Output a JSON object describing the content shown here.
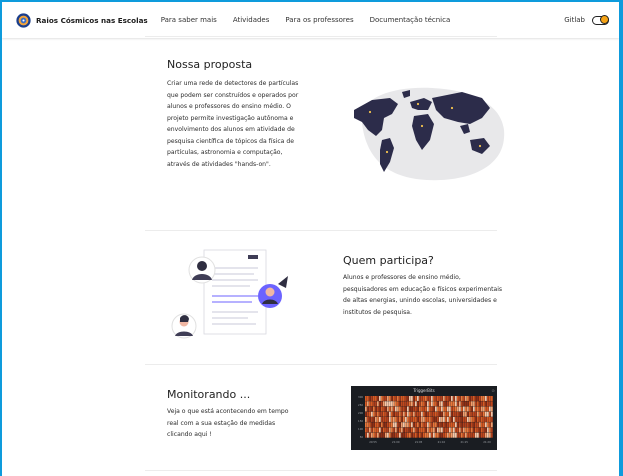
{
  "navbar": {
    "brand": "Raios Cósmicos nas Escolas",
    "items": [
      "Para saber mais",
      "Atividades",
      "Para os professores",
      "Documentação técnica"
    ],
    "right_link": "Gitlab"
  },
  "sections": {
    "proposal": {
      "title": "Nossa proposta",
      "text": "Criar uma rede de detectores de partículas que podem ser construídos e operados por alunos e professores do ensino médio. O projeto permite investigação autônoma e envolvimento dos alunos em atividade de pesquisa científica de tópicos da física de partículas, astronomia e computação, através de atividades \"hands-on\"."
    },
    "participants": {
      "title": "Quem participa?",
      "text": "Alunos e professores de ensino médio, pesquisadores em educação e físicos experimentais de altas energias, unindo escolas, universidades e institutos de pesquisa."
    },
    "monitoring": {
      "title": "Monitorando ...",
      "text": "Veja o que está acontecendo em tempo real com a sua estação de medidas clicando aqui !",
      "panel_title": "TriggerBits",
      "y_ticks": [
        "300",
        "250",
        "200",
        "150",
        "100",
        "50"
      ],
      "x_ticks": [
        "20:55",
        "21:00",
        "21:05",
        "21:10",
        "21:15",
        "21:20"
      ]
    }
  },
  "colors": {
    "accent_blue": "#0e9bdc",
    "toggle": "#f5a316",
    "map": "#2c2c4a",
    "heatmap": "#c0471c"
  }
}
